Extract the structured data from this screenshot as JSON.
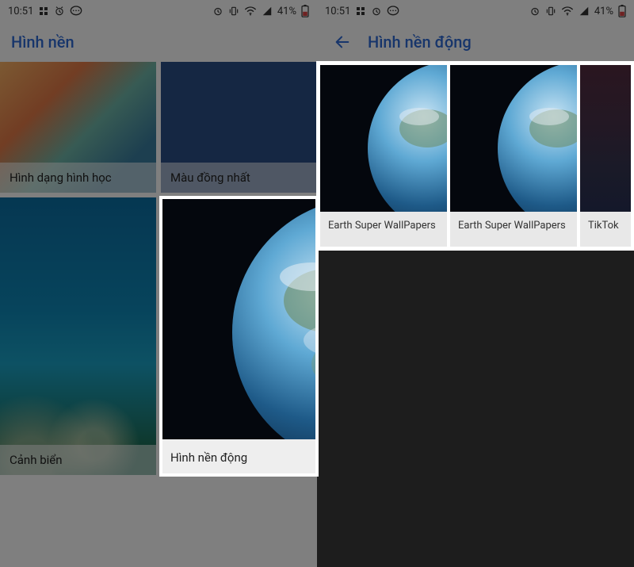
{
  "status": {
    "time": "10:51",
    "battery": "41%"
  },
  "left": {
    "title": "Hình nền",
    "cards": {
      "geometric": "Hình dạng hình học",
      "solid": "Màu đồng nhất",
      "sea": "Cảnh biển",
      "live": "Hình nền động"
    }
  },
  "right": {
    "title": "Hình nền động",
    "cards": {
      "earth1": "Earth Super WallPapers",
      "earth2": "Earth Super WallPapers",
      "tiktok": "TikTok"
    }
  }
}
